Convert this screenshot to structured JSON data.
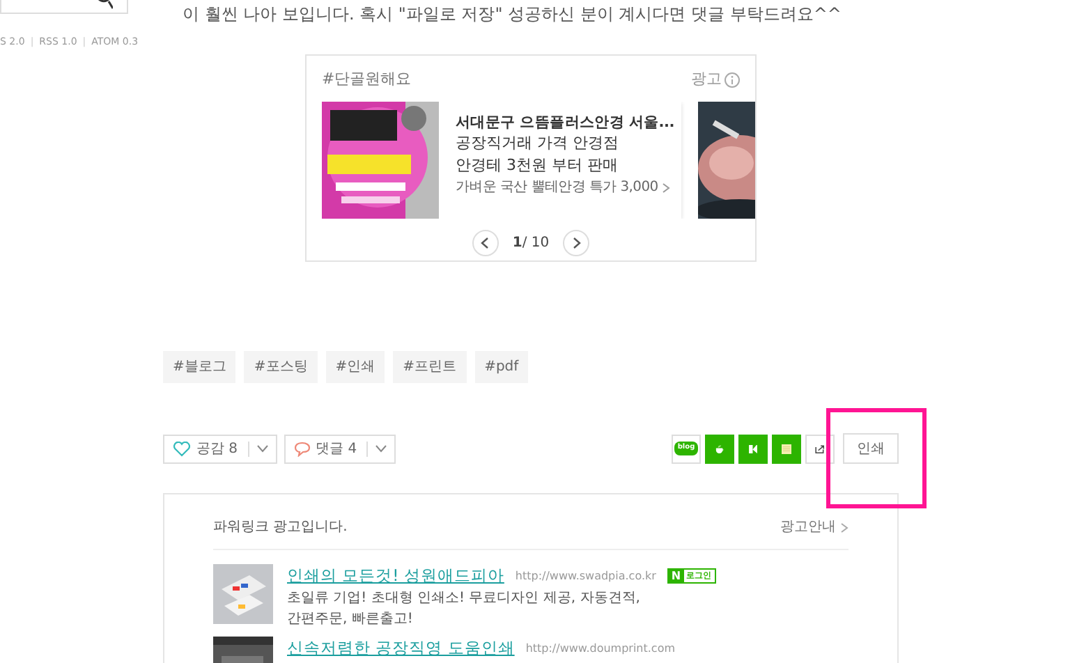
{
  "sidebar": {
    "feeds": [
      "S 2.0",
      "RSS 1.0",
      "ATOM 0.3"
    ],
    "separator": "|"
  },
  "post": {
    "text": "이 훨씬 나아 보입니다. 혹시 \"파일로 저장\" 성공하신 분이 계시다면 댓글 부탁드려요^^"
  },
  "ad_card": {
    "hashtag": "#단골원해요",
    "label": "광고",
    "items": [
      {
        "kind": "full",
        "title": "서대문구 으뜸플러스안경 서울...",
        "lines": [
          "공장직거래 가격 안경점",
          "안경테 3천원 부터 판매"
        ],
        "link": "가벼운 국산 뿔테안경 특가 3,000"
      },
      {
        "kind": "cut"
      }
    ],
    "pager": "**1**/ 10"
  },
  "tags": [
    "#블로그",
    "#포스팅",
    "#인쇄",
    "#프린트",
    "#pdf"
  ],
  "reactions": [
    {
      "kind": "like",
      "label": "공감",
      "count": "8"
    },
    {
      "kind": "comment",
      "label": "댓글",
      "count": "4"
    }
  ],
  "share": [
    {
      "kind": "blog",
      "label": "blog"
    },
    {
      "kind": "cafe"
    },
    {
      "kind": "story"
    },
    {
      "kind": "memo"
    },
    {
      "kind": "external"
    }
  ],
  "print": {
    "label": "인쇄",
    "highlighted": true
  },
  "powerlink": {
    "title": "파워링크 광고입니다.",
    "guide": "광고안내",
    "ads": [
      {
        "title": "인쇄의 모든것! 성원애드피아",
        "url": "http://www.swadpia.co.kr",
        "badge": {
          "mark": "N",
          "text": "로그인"
        },
        "desc": "초일류 기업! 초대형 인쇄소! 무료디자인 제공, 자동견적,\n간편주문, 빠른출고!"
      },
      {
        "title": "신속저렴한 공장직영 도움인쇄",
        "url": "http://www.doumprint.com"
      }
    ]
  }
}
